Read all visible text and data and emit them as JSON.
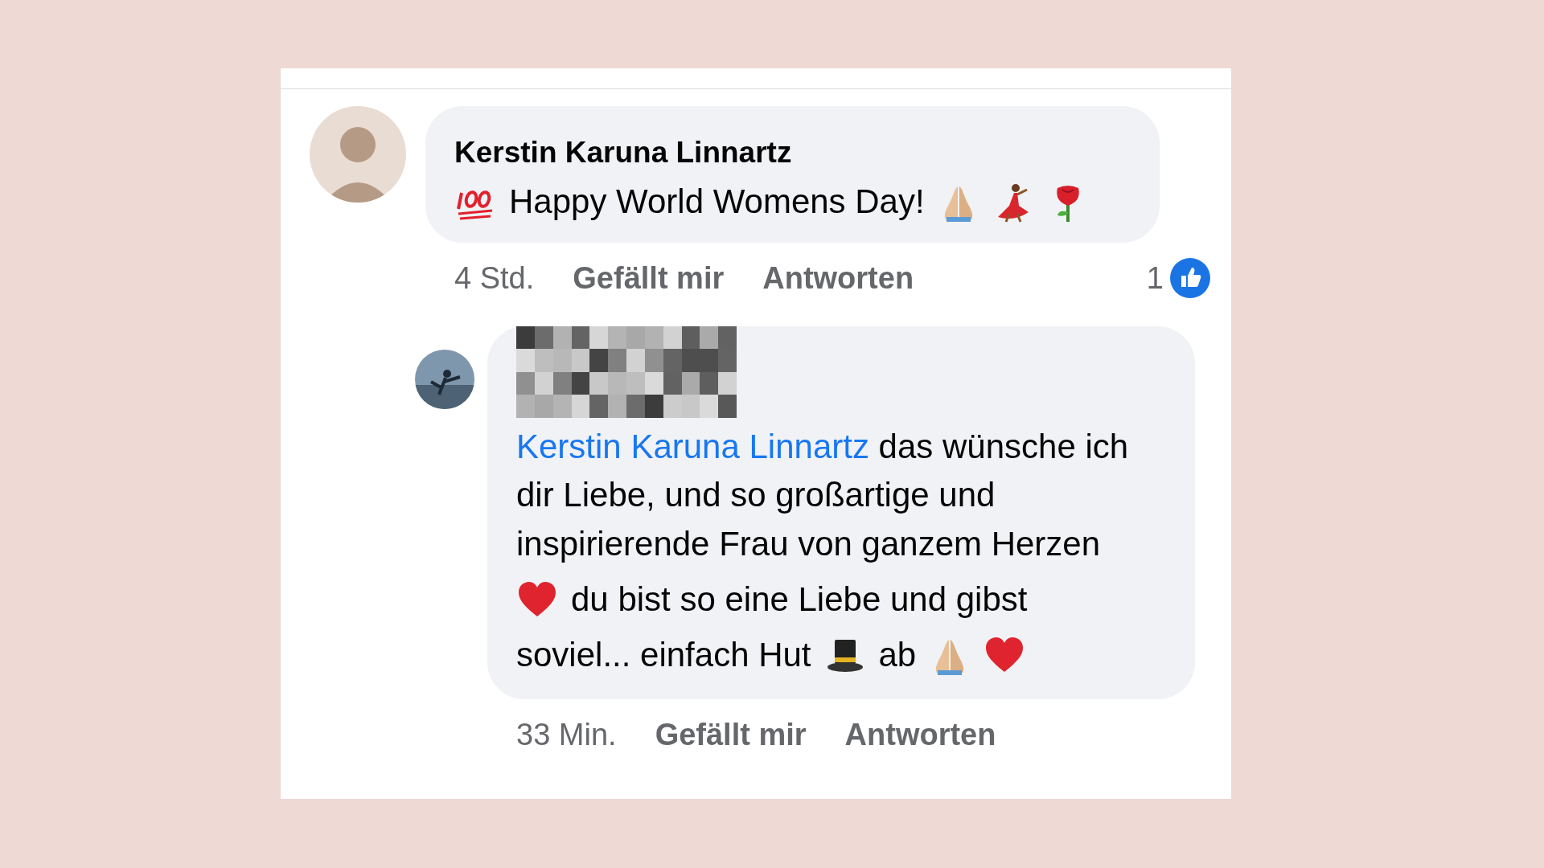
{
  "comments": [
    {
      "author": "Kerstin Karuna Linnartz",
      "segments": [
        {
          "kind": "hundred"
        },
        {
          "kind": "text",
          "text": "Happy World Womens Day!"
        },
        {
          "kind": "praying-hands"
        },
        {
          "kind": "dancer"
        },
        {
          "kind": "rose"
        }
      ],
      "time": "4 Std.",
      "actions": [
        "Gefällt mir",
        "Antworten"
      ],
      "reaction_count": "1",
      "replies": [
        {
          "lines": [
            [
              {
                "kind": "mention",
                "text": "Kerstin Karuna Linnartz"
              },
              {
                "kind": "text",
                "text": "das wünsche ich dir Liebe, und so großartige und inspirierende Frau von ganzem Herzen"
              }
            ],
            [
              {
                "kind": "heart"
              },
              {
                "kind": "text",
                "text": "du bist so eine Liebe und gibst"
              }
            ],
            [
              {
                "kind": "text",
                "text": "soviel... einfach Hut"
              },
              {
                "kind": "top-hat"
              },
              {
                "kind": "text",
                "text": "ab"
              },
              {
                "kind": "praying-hands"
              },
              {
                "kind": "heart"
              }
            ]
          ],
          "time": "33 Min.",
          "actions": [
            "Gefällt mir",
            "Antworten"
          ]
        }
      ]
    }
  ]
}
